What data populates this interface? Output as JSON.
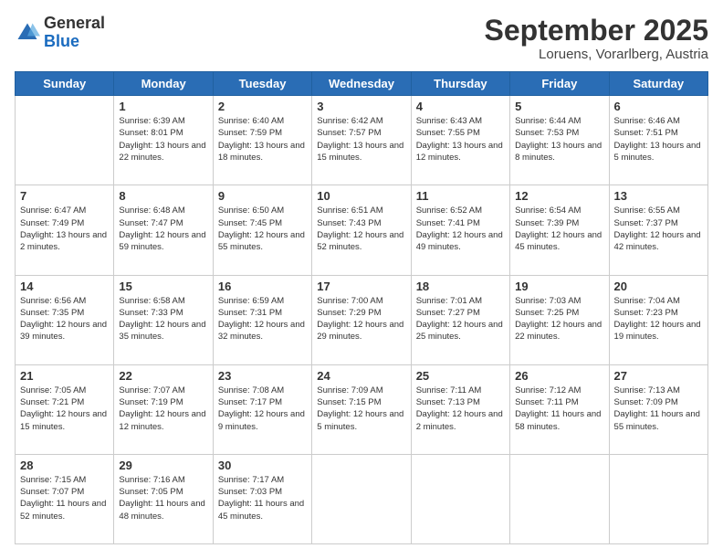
{
  "logo": {
    "general": "General",
    "blue": "Blue"
  },
  "header": {
    "month": "September 2025",
    "location": "Loruens, Vorarlberg, Austria"
  },
  "weekdays": [
    "Sunday",
    "Monday",
    "Tuesday",
    "Wednesday",
    "Thursday",
    "Friday",
    "Saturday"
  ],
  "weeks": [
    [
      {
        "day": "",
        "sunrise": "",
        "sunset": "",
        "daylight": ""
      },
      {
        "day": "1",
        "sunrise": "Sunrise: 6:39 AM",
        "sunset": "Sunset: 8:01 PM",
        "daylight": "Daylight: 13 hours and 22 minutes."
      },
      {
        "day": "2",
        "sunrise": "Sunrise: 6:40 AM",
        "sunset": "Sunset: 7:59 PM",
        "daylight": "Daylight: 13 hours and 18 minutes."
      },
      {
        "day": "3",
        "sunrise": "Sunrise: 6:42 AM",
        "sunset": "Sunset: 7:57 PM",
        "daylight": "Daylight: 13 hours and 15 minutes."
      },
      {
        "day": "4",
        "sunrise": "Sunrise: 6:43 AM",
        "sunset": "Sunset: 7:55 PM",
        "daylight": "Daylight: 13 hours and 12 minutes."
      },
      {
        "day": "5",
        "sunrise": "Sunrise: 6:44 AM",
        "sunset": "Sunset: 7:53 PM",
        "daylight": "Daylight: 13 hours and 8 minutes."
      },
      {
        "day": "6",
        "sunrise": "Sunrise: 6:46 AM",
        "sunset": "Sunset: 7:51 PM",
        "daylight": "Daylight: 13 hours and 5 minutes."
      }
    ],
    [
      {
        "day": "7",
        "sunrise": "Sunrise: 6:47 AM",
        "sunset": "Sunset: 7:49 PM",
        "daylight": "Daylight: 13 hours and 2 minutes."
      },
      {
        "day": "8",
        "sunrise": "Sunrise: 6:48 AM",
        "sunset": "Sunset: 7:47 PM",
        "daylight": "Daylight: 12 hours and 59 minutes."
      },
      {
        "day": "9",
        "sunrise": "Sunrise: 6:50 AM",
        "sunset": "Sunset: 7:45 PM",
        "daylight": "Daylight: 12 hours and 55 minutes."
      },
      {
        "day": "10",
        "sunrise": "Sunrise: 6:51 AM",
        "sunset": "Sunset: 7:43 PM",
        "daylight": "Daylight: 12 hours and 52 minutes."
      },
      {
        "day": "11",
        "sunrise": "Sunrise: 6:52 AM",
        "sunset": "Sunset: 7:41 PM",
        "daylight": "Daylight: 12 hours and 49 minutes."
      },
      {
        "day": "12",
        "sunrise": "Sunrise: 6:54 AM",
        "sunset": "Sunset: 7:39 PM",
        "daylight": "Daylight: 12 hours and 45 minutes."
      },
      {
        "day": "13",
        "sunrise": "Sunrise: 6:55 AM",
        "sunset": "Sunset: 7:37 PM",
        "daylight": "Daylight: 12 hours and 42 minutes."
      }
    ],
    [
      {
        "day": "14",
        "sunrise": "Sunrise: 6:56 AM",
        "sunset": "Sunset: 7:35 PM",
        "daylight": "Daylight: 12 hours and 39 minutes."
      },
      {
        "day": "15",
        "sunrise": "Sunrise: 6:58 AM",
        "sunset": "Sunset: 7:33 PM",
        "daylight": "Daylight: 12 hours and 35 minutes."
      },
      {
        "day": "16",
        "sunrise": "Sunrise: 6:59 AM",
        "sunset": "Sunset: 7:31 PM",
        "daylight": "Daylight: 12 hours and 32 minutes."
      },
      {
        "day": "17",
        "sunrise": "Sunrise: 7:00 AM",
        "sunset": "Sunset: 7:29 PM",
        "daylight": "Daylight: 12 hours and 29 minutes."
      },
      {
        "day": "18",
        "sunrise": "Sunrise: 7:01 AM",
        "sunset": "Sunset: 7:27 PM",
        "daylight": "Daylight: 12 hours and 25 minutes."
      },
      {
        "day": "19",
        "sunrise": "Sunrise: 7:03 AM",
        "sunset": "Sunset: 7:25 PM",
        "daylight": "Daylight: 12 hours and 22 minutes."
      },
      {
        "day": "20",
        "sunrise": "Sunrise: 7:04 AM",
        "sunset": "Sunset: 7:23 PM",
        "daylight": "Daylight: 12 hours and 19 minutes."
      }
    ],
    [
      {
        "day": "21",
        "sunrise": "Sunrise: 7:05 AM",
        "sunset": "Sunset: 7:21 PM",
        "daylight": "Daylight: 12 hours and 15 minutes."
      },
      {
        "day": "22",
        "sunrise": "Sunrise: 7:07 AM",
        "sunset": "Sunset: 7:19 PM",
        "daylight": "Daylight: 12 hours and 12 minutes."
      },
      {
        "day": "23",
        "sunrise": "Sunrise: 7:08 AM",
        "sunset": "Sunset: 7:17 PM",
        "daylight": "Daylight: 12 hours and 9 minutes."
      },
      {
        "day": "24",
        "sunrise": "Sunrise: 7:09 AM",
        "sunset": "Sunset: 7:15 PM",
        "daylight": "Daylight: 12 hours and 5 minutes."
      },
      {
        "day": "25",
        "sunrise": "Sunrise: 7:11 AM",
        "sunset": "Sunset: 7:13 PM",
        "daylight": "Daylight: 12 hours and 2 minutes."
      },
      {
        "day": "26",
        "sunrise": "Sunrise: 7:12 AM",
        "sunset": "Sunset: 7:11 PM",
        "daylight": "Daylight: 11 hours and 58 minutes."
      },
      {
        "day": "27",
        "sunrise": "Sunrise: 7:13 AM",
        "sunset": "Sunset: 7:09 PM",
        "daylight": "Daylight: 11 hours and 55 minutes."
      }
    ],
    [
      {
        "day": "28",
        "sunrise": "Sunrise: 7:15 AM",
        "sunset": "Sunset: 7:07 PM",
        "daylight": "Daylight: 11 hours and 52 minutes."
      },
      {
        "day": "29",
        "sunrise": "Sunrise: 7:16 AM",
        "sunset": "Sunset: 7:05 PM",
        "daylight": "Daylight: 11 hours and 48 minutes."
      },
      {
        "day": "30",
        "sunrise": "Sunrise: 7:17 AM",
        "sunset": "Sunset: 7:03 PM",
        "daylight": "Daylight: 11 hours and 45 minutes."
      },
      {
        "day": "",
        "sunrise": "",
        "sunset": "",
        "daylight": ""
      },
      {
        "day": "",
        "sunrise": "",
        "sunset": "",
        "daylight": ""
      },
      {
        "day": "",
        "sunrise": "",
        "sunset": "",
        "daylight": ""
      },
      {
        "day": "",
        "sunrise": "",
        "sunset": "",
        "daylight": ""
      }
    ]
  ]
}
